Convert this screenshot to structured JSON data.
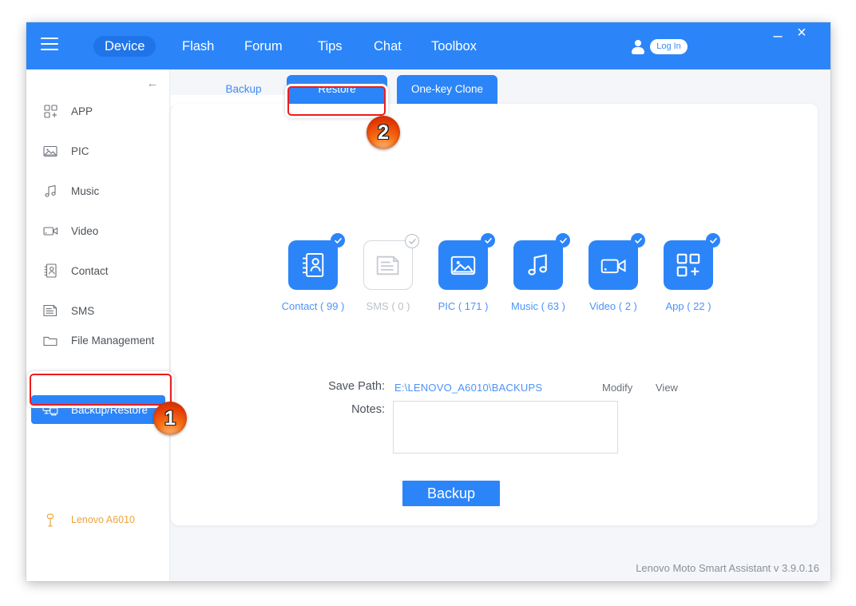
{
  "titlebar": {
    "menu_icon": "hamburger-icon",
    "nav": [
      {
        "label": "Device",
        "active": true
      },
      {
        "label": "Flash",
        "active": false
      },
      {
        "label": "Forum",
        "active": false
      },
      {
        "label": "Tips",
        "active": false
      },
      {
        "label": "Chat",
        "active": false
      },
      {
        "label": "Toolbox",
        "active": false
      }
    ],
    "user_icon": "user-icon",
    "login_label": "Log In",
    "minimize_glyph": "–",
    "close_glyph": "×",
    "accent_color": "#2b85f8"
  },
  "sidebar": {
    "collapse_glyph": "←",
    "items": [
      {
        "label": "APP",
        "icon": "app-grid-icon",
        "selected": false
      },
      {
        "label": "PIC",
        "icon": "picture-icon",
        "selected": false
      },
      {
        "label": "Music",
        "icon": "music-note-icon",
        "selected": false
      },
      {
        "label": "Video",
        "icon": "video-camera-icon",
        "selected": false
      },
      {
        "label": "Contact",
        "icon": "contact-card-icon",
        "selected": false
      },
      {
        "label": "SMS",
        "icon": "sms-message-icon",
        "selected": false
      },
      {
        "label": "File Management",
        "icon": "folder-icon",
        "selected": false
      },
      {
        "label": "Backup/Restore",
        "icon": "backup-restore-icon",
        "selected": true
      }
    ],
    "device": {
      "label": "Lenovo A6010",
      "icon": "usb-device-icon",
      "color": "#f0a43c"
    }
  },
  "content": {
    "tabs": [
      {
        "label": "Backup",
        "active": true
      },
      {
        "label": "Restore",
        "active": false
      },
      {
        "label": "One-key Clone",
        "active": false
      }
    ],
    "categories": [
      {
        "label": "Contact ( 99 )",
        "icon": "contact-card-icon",
        "checked": true,
        "count": 99
      },
      {
        "label": "SMS ( 0 )",
        "icon": "sms-message-icon",
        "checked": false,
        "count": 0
      },
      {
        "label": "PIC ( 171 )",
        "icon": "picture-icon",
        "checked": true,
        "count": 171
      },
      {
        "label": "Music ( 63 )",
        "icon": "music-note-icon",
        "checked": true,
        "count": 63
      },
      {
        "label": "Video ( 2 )",
        "icon": "video-camera-icon",
        "checked": true,
        "count": 2
      },
      {
        "label": "App ( 22 )",
        "icon": "app-grid-icon",
        "checked": true,
        "count": 22
      }
    ],
    "form": {
      "save_path_label": "Save Path:",
      "save_path_value": "E:\\LENOVO_A6010\\BACKUPS",
      "modify_label": "Modify",
      "view_label": "View",
      "notes_label": "Notes:",
      "notes_value": "",
      "notes_placeholder": ""
    },
    "backup_button_label": "Backup"
  },
  "footer": {
    "version_text": "Lenovo Moto Smart Assistant v 3.9.0.16"
  },
  "annotations": {
    "step_1": "1",
    "step_2": "2",
    "highlight_color": "#ee1c1c"
  }
}
